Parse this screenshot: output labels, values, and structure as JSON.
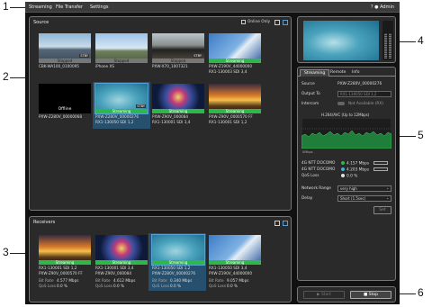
{
  "callouts": [
    "1",
    "2",
    "3",
    "4",
    "5",
    "6"
  ],
  "topbar": {
    "menu": [
      "Streaming",
      "File Transfer",
      "Settings"
    ],
    "help_icon": "?",
    "user_label": "Admin"
  },
  "source": {
    "title": "Source",
    "online_only": "Online Only",
    "items": [
      {
        "caption1": "CBK-WA100_0100095",
        "caption2": "",
        "status": "Stopped",
        "tag": "STBY"
      },
      {
        "caption1": "iPhone XS",
        "caption2": "",
        "status": "Stopped",
        "tag": ""
      },
      {
        "caption1": "PXW-X70_1007321",
        "caption2": "",
        "status": "Stopped",
        "tag": "STBY"
      },
      {
        "caption1": "PXW-Z190V_44000000",
        "caption2": "RX1-130003 SDI 3,4",
        "status": "Streaming",
        "tag": ""
      },
      {
        "caption1": "PXW-Z280V_00000068",
        "caption2": "",
        "status": "Offline",
        "tag": ""
      },
      {
        "caption1": "PXW-Z280V_00000276",
        "caption2": "RX1-130050 SDI 1,2",
        "status": "Streaming",
        "tag": "STBY"
      },
      {
        "caption1": "PXW-Z90V_000084",
        "caption2": "RX1-130001 SDI 3,4",
        "status": "Streaming",
        "tag": ""
      },
      {
        "caption1": "PXW-Z90V_0000570 FF",
        "caption2": "RX1-130001 SDI 1,2",
        "status": "Streaming",
        "tag": ""
      }
    ]
  },
  "receivers": {
    "title": "Receivers",
    "items": [
      {
        "caption1": "RX1-130001 SDI 1,2",
        "caption2": "PXW-Z90V_0000570 FF",
        "status": "Streaming",
        "bitrate_label": "Bit Rate",
        "bitrate": "4.577 Mbps",
        "loss_label": "QoS Loss",
        "loss": "0.0 %"
      },
      {
        "caption1": "RX1-130001 SDI 3,4",
        "caption2": "PXW-Z90V_000084",
        "status": "Streaming",
        "bitrate_label": "Bit Rate",
        "bitrate": "4.612 Mbps",
        "loss_label": "QoS Loss",
        "loss": "0.0 %"
      },
      {
        "caption1": "RX1-130050 SDI 1,2",
        "caption2": "PXW-Z280V_00000276",
        "status": "Streaming",
        "bitrate_label": "Bit Rate",
        "bitrate": "0.340 Mbps",
        "loss_label": "QoS Loss",
        "loss": "0.0 %"
      },
      {
        "caption1": "RX1-130050 SDI 3,4",
        "caption2": "PXW-Z190V_44000000",
        "status": "Streaming",
        "bitrate_label": "Bit Rate",
        "bitrate": "9.057 Mbps",
        "loss_label": "QoS Loss",
        "loss": "0.0 %"
      }
    ]
  },
  "detail": {
    "tabs": [
      "Streaming",
      "Remote",
      "Info"
    ],
    "source_label": "Source",
    "source_value": "PXW-Z280V_00000276",
    "output_label": "Output To",
    "output_value": "RX1-130050 SDI 1,2",
    "intercom_label": "Intercom",
    "intercom_value": "Not Available (RX)",
    "chart_title": "H.264/AVC (Up to 12Mbps)",
    "chart_top_label": "12Mbps",
    "chart_bottom_label": "0Mbps",
    "links": [
      {
        "name": "4G NTT DOCOMO",
        "value": "4.157 Mbps",
        "color": "#2fb84a"
      },
      {
        "name": "4G NTT DOCOMO",
        "value": "4.203 Mbps",
        "color": "#3fb0e0"
      },
      {
        "name": "QoS Loss",
        "value": "0.0 %",
        "color": "#e0e0e0"
      }
    ],
    "network_range_label": "Network Range",
    "network_range_value": "very high",
    "delay_label": "Delay",
    "delay_value": "Short (1.5sec)",
    "set_button": "Set"
  },
  "controls": {
    "start_label": "Start",
    "stop_label": "Stop"
  }
}
